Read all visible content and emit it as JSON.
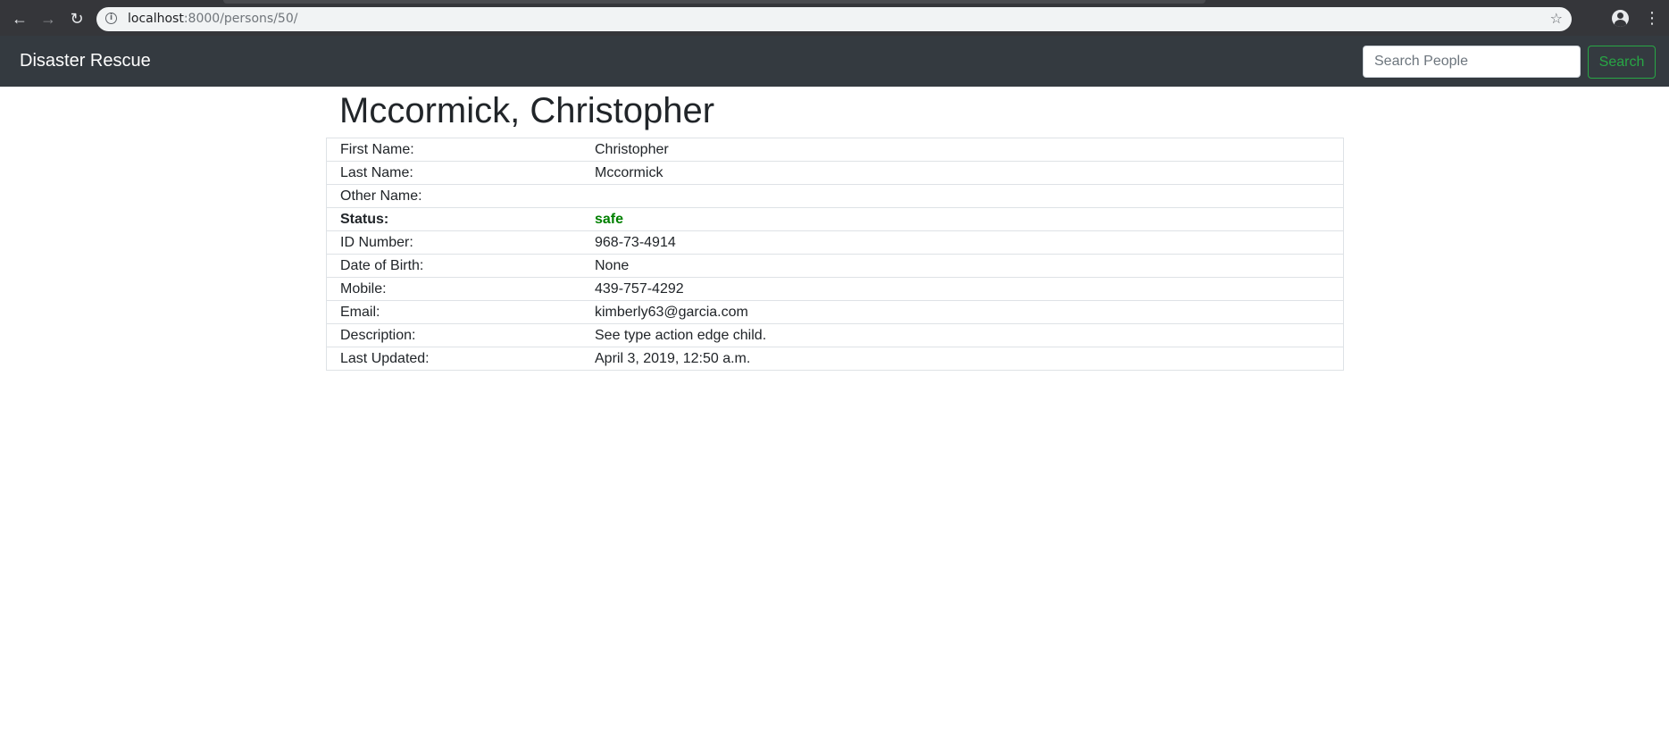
{
  "browser": {
    "url_host": "localhost",
    "url_rest": ":8000/persons/50/",
    "back_glyph": "←",
    "forward_glyph": "→",
    "reload_glyph": "↻",
    "star_glyph": "☆",
    "menu_glyph": "⋮",
    "icons": [
      "back-arrow-icon",
      "forward-arrow-icon",
      "reload-icon",
      "info-icon",
      "star-icon",
      "profile-icon",
      "kebab-menu-icon"
    ]
  },
  "navbar": {
    "brand": "Disaster Rescue",
    "search_placeholder": "Search People",
    "search_value": "",
    "search_button_label": "Search",
    "accent_color": "#28a745",
    "background_color": "#343a40"
  },
  "person": {
    "title": "Mccormick, Christopher",
    "status_color": "#008000",
    "rows": [
      {
        "label": "First Name:",
        "value": "Christopher"
      },
      {
        "label": "Last Name:",
        "value": "Mccormick"
      },
      {
        "label": "Other Name:",
        "value": ""
      },
      {
        "label": "Status:",
        "value": "safe"
      },
      {
        "label": "ID Number:",
        "value": "968-73-4914"
      },
      {
        "label": "Date of Birth:",
        "value": "None"
      },
      {
        "label": "Mobile:",
        "value": "439-757-4292"
      },
      {
        "label": "Email:",
        "value": "kimberly63@garcia.com"
      },
      {
        "label": "Description:",
        "value": "See type action edge child."
      },
      {
        "label": "Last Updated:",
        "value": "April 3, 2019, 12:50 a.m."
      }
    ]
  }
}
